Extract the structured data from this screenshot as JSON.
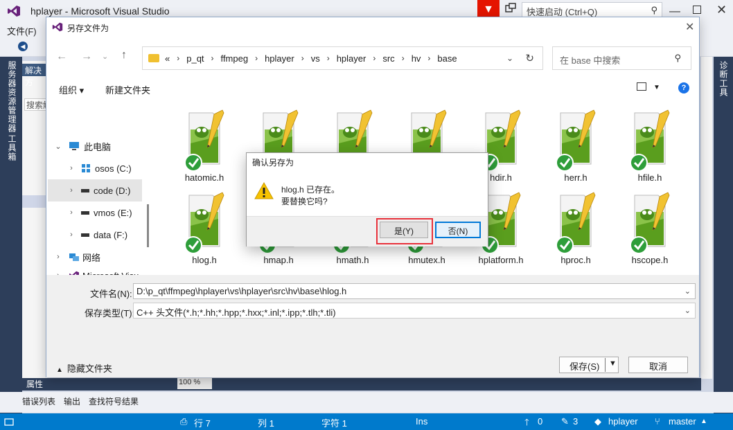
{
  "vs": {
    "title": "hplayer - Microsoft Visual Studio",
    "quick_launch_placeholder": "快速启动 (Ctrl+Q)",
    "menu_file": "文件(F)",
    "left_strip": [
      "服务器资源管理器",
      "工具箱"
    ],
    "right_strip": "诊断工具",
    "solution_title": "解决方",
    "solution_search": "搜索解",
    "zoom": "100 %",
    "props_tab": "属性",
    "output_tabs": [
      "错误列表",
      "输出",
      "查找符号结果"
    ],
    "status": {
      "line": "行 7",
      "col": "列 1",
      "char": "字符 1",
      "ins": "Ins",
      "up": "0",
      "pencil": "3",
      "project": "hplayer",
      "branch": "master"
    }
  },
  "dialog": {
    "title": "另存文件为",
    "breadcrumbs": [
      "«",
      "p_qt",
      "ffmpeg",
      "hplayer",
      "vs",
      "hplayer",
      "src",
      "hv",
      "base"
    ],
    "search_placeholder": "在 base 中搜索",
    "toolbar": {
      "organize": "组织 ▾",
      "new_folder": "新建文件夹"
    },
    "nav": [
      {
        "label": "此电脑",
        "type": "pc"
      },
      {
        "label": "osos (C:)",
        "type": "win"
      },
      {
        "label": "code (D:)",
        "type": "drive",
        "selected": true
      },
      {
        "label": "vmos (E:)",
        "type": "drive"
      },
      {
        "label": "data (F:)",
        "type": "drive"
      },
      {
        "label": "网络",
        "type": "net"
      },
      {
        "label": "Microsoft Visu",
        "type": "vs"
      }
    ],
    "files_row1": [
      "hatomic.h",
      "",
      "",
      "",
      "hdir.h",
      "herr.h",
      "hfile.h"
    ],
    "files_row2": [
      "hlog.h",
      "hmap.h",
      "hmath.h",
      "hmutex.h",
      "hplatform.h",
      "hproc.h",
      "hscope.h"
    ],
    "filename_label": "文件名(N):",
    "filename_value": "D:\\p_qt\\ffmpeg\\hplayer\\vs\\hplayer\\src\\hv\\base\\hlog.h",
    "filetype_label": "保存类型(T):",
    "filetype_value": "C++ 头文件(*.h;*.hh;*.hpp;*.hxx;*.inl;*.ipp;*.tlh;*.tli)",
    "hide_folders": "隐藏文件夹",
    "save": "保存(S)",
    "cancel": "取消"
  },
  "confirm": {
    "title": "确认另存为",
    "line1": "hlog.h 已存在。",
    "line2": "要替换它吗?",
    "yes": "是(Y)",
    "no": "否(N)"
  },
  "colors": {
    "accent": "#007acc",
    "highlight": "#e8303a",
    "vs_purple": "#68217a"
  }
}
